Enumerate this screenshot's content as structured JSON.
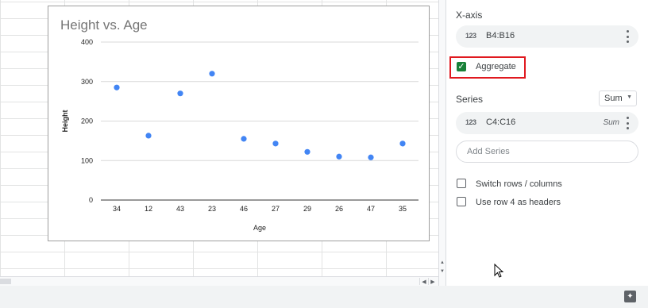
{
  "chart_data": {
    "type": "scatter",
    "title": "Height vs. Age",
    "xlabel": "Age",
    "ylabel": "Height",
    "categories": [
      "34",
      "12",
      "43",
      "23",
      "46",
      "27",
      "29",
      "26",
      "47",
      "35"
    ],
    "values": [
      285,
      163,
      270,
      320,
      155,
      143,
      122,
      110,
      108,
      143
    ],
    "ylim": [
      0,
      400
    ],
    "yticks": [
      0,
      100,
      200,
      300,
      400
    ],
    "grid": true,
    "point_color": "#4285f4"
  },
  "panel": {
    "xaxis_label": "X-axis",
    "xaxis_range": "B4:B16",
    "range_icon": "123",
    "aggregate_label": "Aggregate",
    "aggregate_checked": true,
    "series_label": "Series",
    "aggregate_function": "Sum",
    "series_range": "C4:C16",
    "series_aggregate": "Sum",
    "add_series_placeholder": "Add Series",
    "switch_rows_label": "Switch rows / columns",
    "headers_label": "Use row 4 as headers"
  },
  "colors": {
    "highlight": "#e0191f",
    "checkbox": "#188038"
  }
}
